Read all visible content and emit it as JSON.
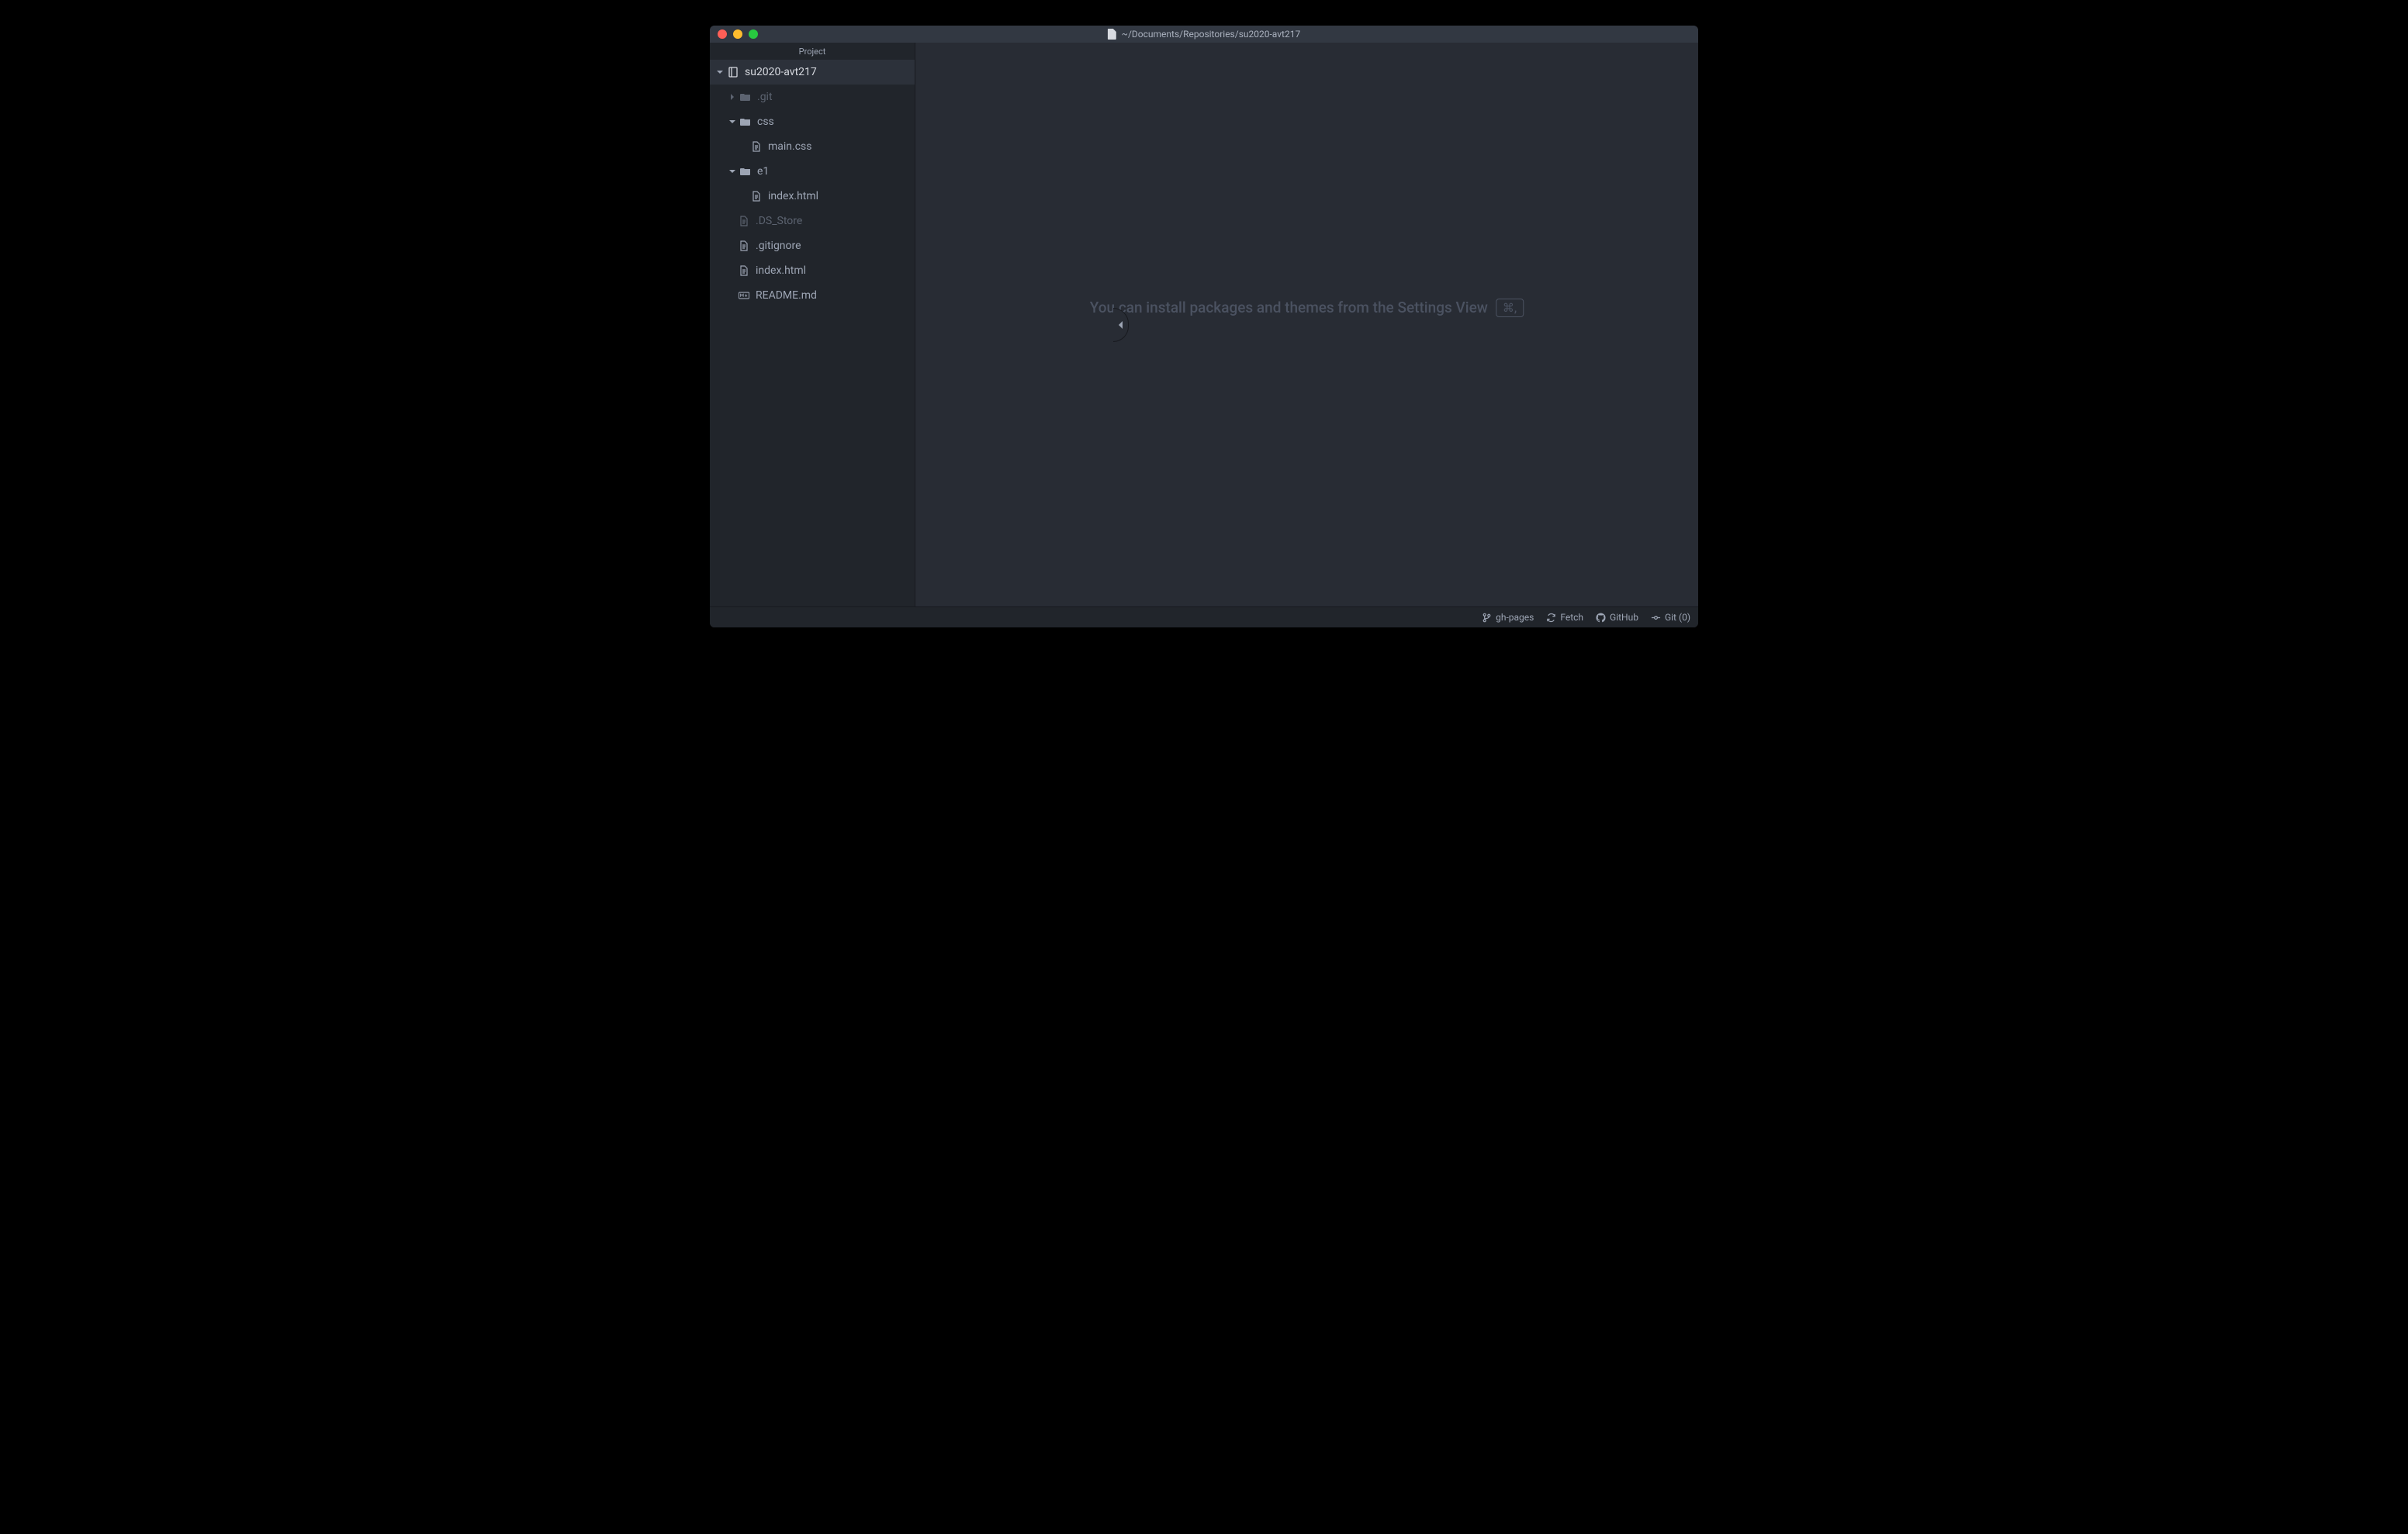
{
  "titlebar": {
    "path": "~/Documents/Repositories/su2020-avt217"
  },
  "sidebar": {
    "header": "Project",
    "root": "su2020-avt217",
    "git": ".git",
    "css": "css",
    "css_file": "main.css",
    "e1": "e1",
    "e1_file": "index.html",
    "ds": ".DS_Store",
    "gitignore": ".gitignore",
    "index": "index.html",
    "readme": "README.md"
  },
  "main": {
    "hint": "You can install packages and themes from the Settings View",
    "shortcut": "⌘,"
  },
  "status": {
    "branch": "gh-pages",
    "fetch": "Fetch",
    "github": "GitHub",
    "git": "Git (0)"
  }
}
